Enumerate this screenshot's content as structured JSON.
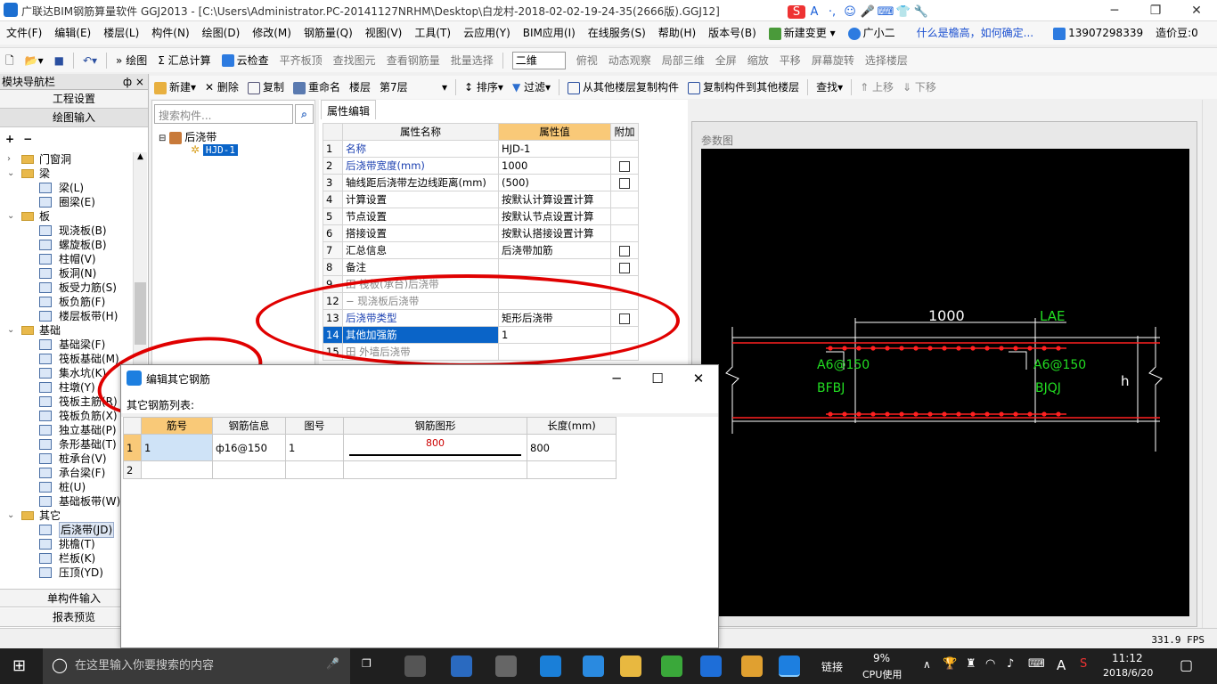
{
  "window": {
    "title": "广联达BIM钢筋算量软件 GGJ2013 - [C:\\Users\\Administrator.PC-20141127NRHM\\Desktop\\白龙村-2018-02-02-19-24-35(2666版).GGJ12]",
    "minimize": "─",
    "maximize": "❐",
    "close": "✕"
  },
  "ime_bar": [
    "S",
    "A",
    "·,",
    "☺",
    "🎤",
    "⌨",
    "👕",
    "🔧"
  ],
  "menu": [
    "文件(F)",
    "编辑(E)",
    "楼层(L)",
    "构件(N)",
    "绘图(D)",
    "修改(M)",
    "钢筋量(Q)",
    "视图(V)",
    "工具(T)",
    "云应用(Y)",
    "BIM应用(I)",
    "在线服务(S)",
    "帮助(H)",
    "版本号(B)",
    "新建变更",
    "广小二",
    "什么是檐高，如何确定...",
    "13907298339",
    "造价豆:0"
  ],
  "toolbar1": [
    "绘图",
    "汇总计算",
    "云检查",
    "平齐板顶",
    "查找图元",
    "查看钢筋量",
    "批量选择",
    "二维",
    "俯视",
    "动态观察",
    "局部三维",
    "全屏",
    "缩放",
    "平移",
    "屏幕旋转",
    "选择楼层"
  ],
  "toolbar2": [
    "新建",
    "删除",
    "复制",
    "重命名",
    "楼层",
    "第7层",
    "排序",
    "过滤",
    "从其他楼层复制构件",
    "复制构件到其他楼层",
    "查找",
    "上移",
    "下移"
  ],
  "nav": {
    "header": "模块导航栏",
    "pin": "ф ×",
    "sections_top": [
      "工程设置",
      "绘图输入"
    ],
    "sections_bottom": [
      "单构件输入",
      "报表预览"
    ],
    "tree": [
      {
        "type": "folder",
        "label": "门窗洞",
        "exp": "+"
      },
      {
        "type": "folder",
        "label": "梁",
        "exp": "−"
      },
      {
        "type": "item",
        "label": "梁(L)"
      },
      {
        "type": "item",
        "label": "圈梁(E)"
      },
      {
        "type": "folder",
        "label": "板",
        "exp": "−"
      },
      {
        "type": "item",
        "label": "现浇板(B)"
      },
      {
        "type": "item",
        "label": "螺旋板(B)"
      },
      {
        "type": "item",
        "label": "柱帽(V)"
      },
      {
        "type": "item",
        "label": "板洞(N)"
      },
      {
        "type": "item",
        "label": "板受力筋(S)"
      },
      {
        "type": "item",
        "label": "板负筋(F)"
      },
      {
        "type": "item",
        "label": "楼层板带(H)"
      },
      {
        "type": "folder",
        "label": "基础",
        "exp": "−"
      },
      {
        "type": "item",
        "label": "基础梁(F)"
      },
      {
        "type": "item",
        "label": "筏板基础(M)"
      },
      {
        "type": "item",
        "label": "集水坑(K)"
      },
      {
        "type": "item",
        "label": "柱墩(Y)"
      },
      {
        "type": "item",
        "label": "筏板主筋(R)"
      },
      {
        "type": "item",
        "label": "筏板负筋(X)"
      },
      {
        "type": "item",
        "label": "独立基础(P)"
      },
      {
        "type": "item",
        "label": "条形基础(T)"
      },
      {
        "type": "item",
        "label": "桩承台(V)"
      },
      {
        "type": "item",
        "label": "承台梁(F)"
      },
      {
        "type": "item",
        "label": "桩(U)"
      },
      {
        "type": "item",
        "label": "基础板带(W)"
      },
      {
        "type": "folder",
        "label": "其它",
        "exp": "−"
      },
      {
        "type": "item",
        "label": "后浇带(JD)",
        "selected": true
      },
      {
        "type": "item",
        "label": "挑檐(T)"
      },
      {
        "type": "item",
        "label": "栏板(K)"
      },
      {
        "type": "item",
        "label": "压顶(YD)"
      }
    ]
  },
  "component_list": {
    "search_placeholder": "搜索构件...",
    "search_btn": "⌕",
    "group": "后浇带",
    "item": "HJD-1"
  },
  "property": {
    "tab": "属性编辑",
    "headers": [
      "属性名称",
      "属性值",
      "附加"
    ],
    "rows": [
      {
        "num": "1",
        "name": "名称",
        "value": "HJD-1",
        "cb": false,
        "blue": true
      },
      {
        "num": "2",
        "name": "后浇带宽度(mm)",
        "value": "1000",
        "cb": true,
        "blue": true
      },
      {
        "num": "3",
        "name": "轴线距后浇带左边线距离(mm)",
        "value": "(500)",
        "cb": true
      },
      {
        "num": "4",
        "name": "计算设置",
        "value": "按默认计算设置计算",
        "cb": false
      },
      {
        "num": "5",
        "name": "节点设置",
        "value": "按默认节点设置计算",
        "cb": false
      },
      {
        "num": "6",
        "name": "搭接设置",
        "value": "按默认搭接设置计算",
        "cb": false
      },
      {
        "num": "7",
        "name": "汇总信息",
        "value": "后浇带加筋",
        "cb": true
      },
      {
        "num": "8",
        "name": "备注",
        "value": "",
        "cb": true
      },
      {
        "num": "9",
        "name": "田 筏板(承台)后浇带",
        "value": "",
        "cb": false,
        "gray": true
      },
      {
        "num": "12",
        "name": "− 现浇板后浇带",
        "value": "",
        "cb": false,
        "gray": true
      },
      {
        "num": "13",
        "name": "  后浇带类型",
        "value": "矩形后浇带",
        "cb": true,
        "blue": true
      },
      {
        "num": "14",
        "name": "  其他加强筋",
        "value": "1",
        "cb": false,
        "hl": true
      },
      {
        "num": "15",
        "name": "田 外墙后浇带",
        "value": "",
        "cb": false,
        "gray": true
      }
    ]
  },
  "param_view": {
    "title": "参数图",
    "dim_width": "1000",
    "dim_lae": "LAE",
    "left_rebar": "A6@150",
    "right_rebar": "A6@150",
    "left_tag": "BFBJ",
    "right_tag": "BJQJ",
    "height_label": "h"
  },
  "status": {
    "fps": "331.9 FPS"
  },
  "dialog": {
    "title": "编辑其它钢筋",
    "list_label": "其它钢筋列表:",
    "headers": [
      "筋号",
      "钢筋信息",
      "图号",
      "钢筋图形",
      "长度(mm)"
    ],
    "rows": [
      {
        "rn": "1",
        "no": "1",
        "info": "ф16@150",
        "fig": "1",
        "shape_len": "800",
        "length": "800"
      },
      {
        "rn": "2",
        "no": "",
        "info": "",
        "fig": "",
        "shape_len": "",
        "length": ""
      }
    ],
    "min": "─",
    "max": "☐",
    "close": "✕"
  },
  "taskbar": {
    "search_placeholder": "在这里输入你要搜索的内容",
    "network": "链接",
    "cpu_pct": "9%",
    "cpu_label": "CPU使用",
    "ime": "A",
    "time": "11:12",
    "date": "2018/6/20"
  },
  "colors": {
    "accent_blue": "#0a64c8",
    "header_orange": "#f9c978",
    "annotation_red": "#e00000",
    "cad_rebar": "#ff2020",
    "cad_label": "#22dd22"
  }
}
